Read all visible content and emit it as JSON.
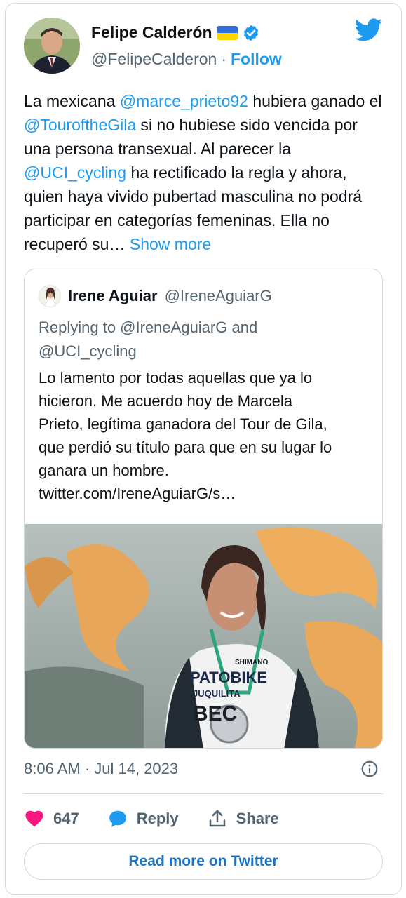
{
  "author": {
    "name": "Felipe Calderón",
    "handle": "@FelipeCalderon",
    "separator": "·",
    "follow_label": "Follow"
  },
  "tweet": {
    "parts": [
      {
        "text": "La mexicana ",
        "mention": false
      },
      {
        "text": "@marce_prieto92",
        "mention": true
      },
      {
        "text": " hubiera ganado el ",
        "mention": false
      },
      {
        "text": "@TouroftheGila",
        "mention": true
      },
      {
        "text": " si no hubiese sido vencida por una persona transexual. Al parecer la ",
        "mention": false
      },
      {
        "text": "@UCI_cycling",
        "mention": true
      },
      {
        "text": " ha rectificado la regla y ahora, quien haya vivido pubertad masculina no podrá participar en categorías femeninas. Ella no recuperó su… ",
        "mention": false
      }
    ],
    "show_more": "Show more"
  },
  "quote": {
    "name": "Irene Aguiar",
    "handle": "@IreneAguiarG",
    "replying_line1": "Replying to @IreneAguiarG and",
    "replying_line2": "@UCI_cycling",
    "text_lines": [
      "Lo lamento por todas aquellas que ya lo",
      "hicieron. Me acuerdo hoy de Marcela",
      "Prieto, legítima ganadora del Tour de Gila,",
      "que perdió su título para que en su lugar lo",
      "ganara un hombre.",
      "twitter.com/IreneAguiarG/s…"
    ],
    "photo_jersey_text": {
      "line1": "SHIMANO",
      "line2": "PATOBIKE",
      "line3": "JUQUILITA",
      "line4": "BEC"
    }
  },
  "meta": {
    "timestamp": "8:06 AM · Jul 14, 2023"
  },
  "actions": {
    "like_count": "647",
    "reply_label": "Reply",
    "share_label": "Share"
  },
  "read_more": "Read more on Twitter",
  "colors": {
    "accent": "#1d9bf0",
    "like": "#f91880",
    "secondary_text": "#536471",
    "border": "#cfd9de"
  },
  "icons": [
    "twitter-bird-icon",
    "verified-badge-icon",
    "ukraine-flag-icon",
    "info-icon",
    "heart-icon",
    "reply-bubble-icon",
    "share-icon"
  ]
}
